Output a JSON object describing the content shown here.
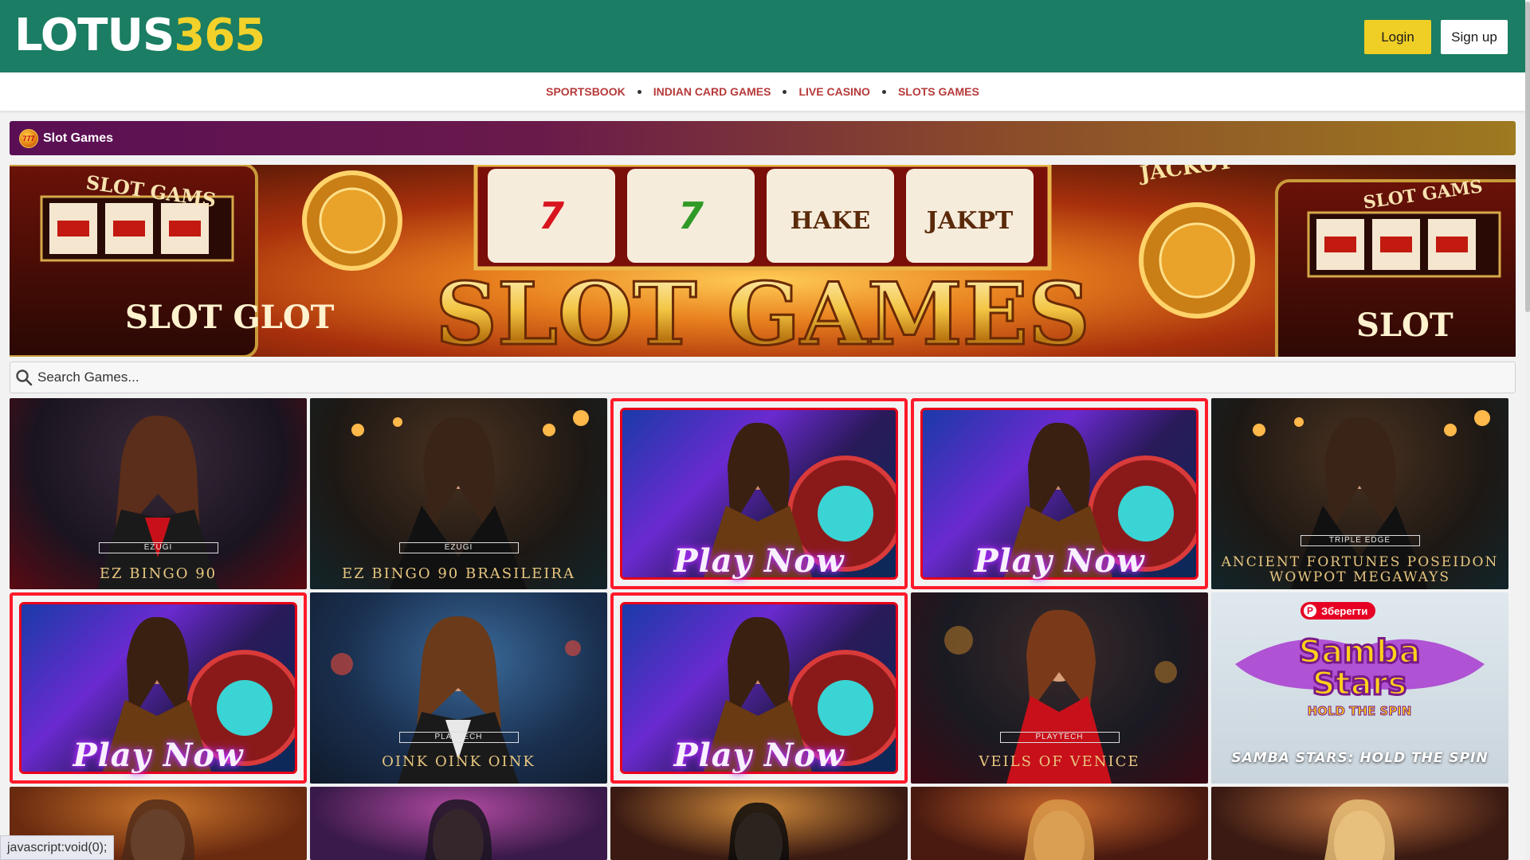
{
  "header": {
    "logo_part1": "LOTUS",
    "logo_part2": "365",
    "login_label": "Login",
    "signup_label": "Sign up"
  },
  "nav": {
    "items": [
      "SPORTSBOOK",
      "INDIAN CARD GAMES",
      "LIVE CASINO",
      "SLOTS GAMES"
    ]
  },
  "section": {
    "title": "Slot Games",
    "icon_name": "slot-777-icon",
    "icon_text": "777"
  },
  "banner": {
    "title": "SLOT GAMES",
    "reel_texts": [
      "HAKE",
      "JAKPT"
    ],
    "side_texts": [
      "SLOT GAMS",
      "JACKOT",
      "SLOT GLOT",
      "SLOT GAMS",
      "SLOT"
    ]
  },
  "search": {
    "placeholder": "Search Games..."
  },
  "games": [
    {
      "type": "card",
      "provider": "EZUGI",
      "name": "EZ BINGO 90"
    },
    {
      "type": "card",
      "provider": "EZUGI",
      "name": "EZ BINGO 90 BRASILEIRA"
    },
    {
      "type": "play",
      "play_text": "Play Now"
    },
    {
      "type": "play",
      "play_text": "Play Now"
    },
    {
      "type": "card",
      "provider": "TRIPLE EDGE",
      "name": "ANCIENT FORTUNES POSEIDON WOWPOT MEGAWAYS"
    },
    {
      "type": "play",
      "play_text": "Play Now"
    },
    {
      "type": "card",
      "provider": "PLAYTECH",
      "name": "OINK OINK OINK"
    },
    {
      "type": "play",
      "play_text": "Play Now"
    },
    {
      "type": "card",
      "provider": "PLAYTECH",
      "name": "VEILS OF VENICE"
    },
    {
      "type": "samba",
      "logo_line1": "Samba",
      "logo_line2": "Stars",
      "logo_sub": "HOLD THE SPIN",
      "name": "SAMBA STARS: HOLD THE SPIN",
      "pin_label": "Зберегти"
    }
  ],
  "status_bar": {
    "text": "javascript:void(0);"
  },
  "colors": {
    "header_bg": "#1b7d63",
    "logo_accent": "#f2d22a",
    "login_bg": "#efcf26",
    "nav_text": "#b63a3a",
    "play_border": "#ff1a2a"
  }
}
